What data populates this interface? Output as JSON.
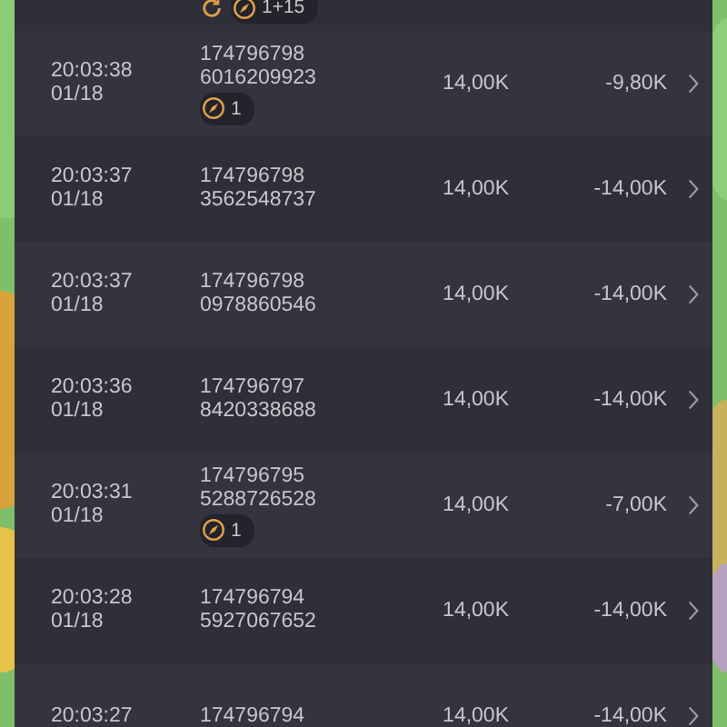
{
  "rows": [
    {
      "tags": [
        {
          "kind": "spin"
        },
        {
          "kind": "compass",
          "count": "1+15"
        }
      ]
    },
    {
      "time": "20:03:38",
      "date": "01/18",
      "ids": [
        "174796798",
        "6016209923"
      ],
      "tags": [
        {
          "kind": "compass",
          "count": "1"
        }
      ],
      "bet": "14,00K",
      "result": "-9,80K"
    },
    {
      "time": "20:03:37",
      "date": "01/18",
      "ids": [
        "174796798",
        "3562548737"
      ],
      "bet": "14,00K",
      "result": "-14,00K"
    },
    {
      "time": "20:03:37",
      "date": "01/18",
      "ids": [
        "174796798",
        "0978860546"
      ],
      "bet": "14,00K",
      "result": "-14,00K"
    },
    {
      "time": "20:03:36",
      "date": "01/18",
      "ids": [
        "174796797",
        "8420338688"
      ],
      "bet": "14,00K",
      "result": "-14,00K"
    },
    {
      "time": "20:03:31",
      "date": "01/18",
      "ids": [
        "174796795",
        "5288726528"
      ],
      "tags": [
        {
          "kind": "compass",
          "count": "1"
        }
      ],
      "bet": "14,00K",
      "result": "-7,00K"
    },
    {
      "time": "20:03:28",
      "date": "01/18",
      "ids": [
        "174796794",
        "5927067652"
      ],
      "bet": "14,00K",
      "result": "-14,00K"
    },
    {
      "time": "20:03:27",
      "ids": [
        "174796794"
      ],
      "bet": "14,00K",
      "result": "-14,00K"
    }
  ]
}
